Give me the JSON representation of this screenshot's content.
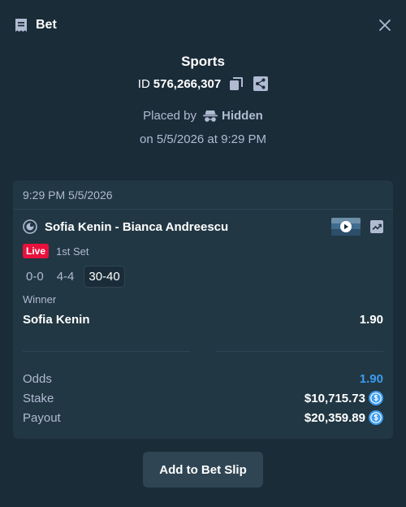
{
  "header": {
    "title": "Bet"
  },
  "info": {
    "sport": "Sports",
    "id_label": "ID",
    "id_value": "576,266,307",
    "placed_by_label": "Placed by",
    "placed_by_user": "Hidden",
    "placed_on": "on 5/5/2026 at 9:29 PM"
  },
  "card": {
    "timestamp": "9:29 PM 5/5/2026",
    "event": "Sofia Kenin - Bianca Andreescu",
    "live_label": "Live",
    "period": "1st Set",
    "scores": [
      "0-0",
      "4-4",
      "30-40"
    ],
    "market": "Winner",
    "selection": "Sofia Kenin",
    "selection_odds": "1.90"
  },
  "totals": {
    "odds_label": "Odds",
    "odds_value": "1.90",
    "stake_label": "Stake",
    "stake_value": "$10,715.73",
    "payout_label": "Payout",
    "payout_value": "$20,359.89"
  },
  "footer": {
    "add_button": "Add to Bet Slip"
  },
  "colors": {
    "background": "#1a2c38",
    "card": "#213743",
    "accent_blue": "#3c9cf0",
    "live_red": "#e9113c",
    "button": "#2f4553"
  },
  "icons": [
    "ticket-icon",
    "close-icon",
    "copy-icon",
    "share-icon",
    "incognito-icon",
    "tennis-icon",
    "play-icon",
    "stats-icon",
    "coin-icon"
  ]
}
